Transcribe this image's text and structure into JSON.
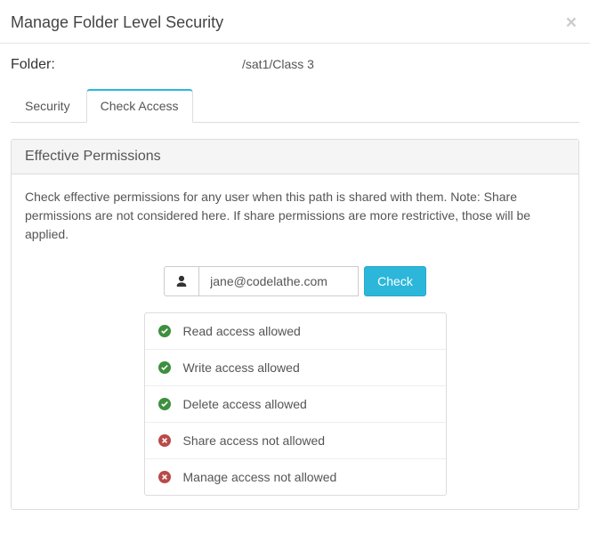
{
  "header": {
    "title": "Manage Folder Level Security"
  },
  "folder": {
    "label": "Folder:",
    "path": "/sat1/Class 3"
  },
  "tabs": {
    "security": "Security",
    "check_access": "Check Access"
  },
  "panel": {
    "heading": "Effective Permissions",
    "description": "Check effective permissions for any user when this path is shared with them. Note: Share permissions are not considered here. If share permissions are more restrictive, those will be applied."
  },
  "form": {
    "user_value": "jane@codelathe.com",
    "check_label": "Check"
  },
  "results": {
    "0": {
      "text": "Read access allowed",
      "allowed": true
    },
    "1": {
      "text": "Write access allowed",
      "allowed": true
    },
    "2": {
      "text": "Delete access allowed",
      "allowed": true
    },
    "3": {
      "text": "Share access not allowed",
      "allowed": false
    },
    "4": {
      "text": "Manage access not allowed",
      "allowed": false
    }
  }
}
